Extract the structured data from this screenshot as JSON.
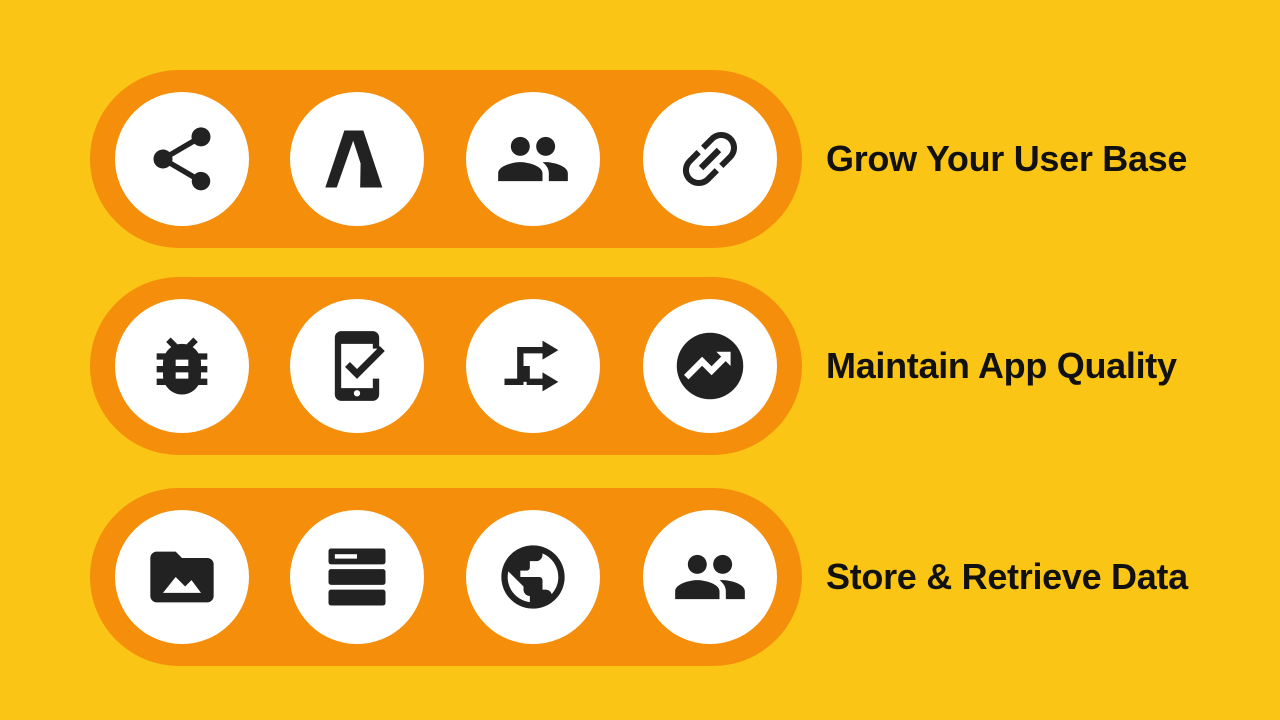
{
  "colors": {
    "background": "#FAC515",
    "pill": "#F48E0B",
    "circle": "#FFFFFF",
    "icon": "#222222",
    "text": "#111111"
  },
  "rows": [
    {
      "label": "Grow Your User Base",
      "icons": [
        "share-icon",
        "ads-icon",
        "people-icon",
        "link-icon"
      ]
    },
    {
      "label": "Maintain App Quality",
      "icons": [
        "bug-icon",
        "mobile-check-icon",
        "shuffle-arrows-icon",
        "trending-up-icon"
      ]
    },
    {
      "label": "Store & Retrieve Data",
      "icons": [
        "folder-image-icon",
        "storage-icon",
        "globe-icon",
        "people-icon"
      ]
    }
  ]
}
